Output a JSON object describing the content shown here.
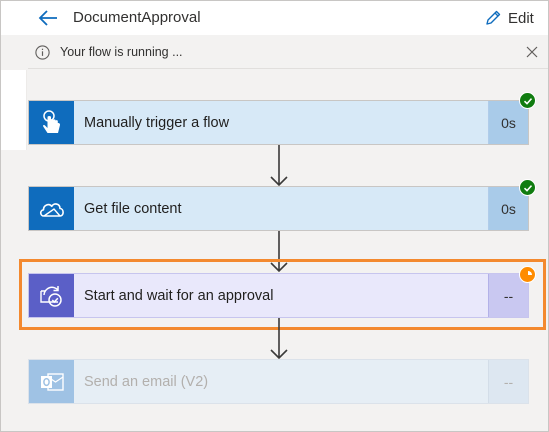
{
  "header": {
    "title": "DocumentApproval",
    "edit_label": "Edit"
  },
  "banner": {
    "message": "Your flow is running ..."
  },
  "steps": [
    {
      "label": "Manually trigger a flow",
      "duration": "0s",
      "status": "succeeded",
      "icon": "touch-hand-icon"
    },
    {
      "label": "Get file content",
      "duration": "0s",
      "status": "succeeded",
      "icon": "onedrive-cloud-icon"
    },
    {
      "label": "Start and wait for an approval",
      "duration": "--",
      "status": "running",
      "icon": "approvals-icon"
    },
    {
      "label": "Send an email (V2)",
      "duration": "--",
      "status": "not-started",
      "icon": "outlook-icon"
    }
  ],
  "colors": {
    "accent_blue": "#0f6cbd",
    "approval_purple": "#5b5fc7",
    "success_green": "#107c10",
    "running_orange": "#ff8c00",
    "highlight_orange": "#f3892e"
  }
}
